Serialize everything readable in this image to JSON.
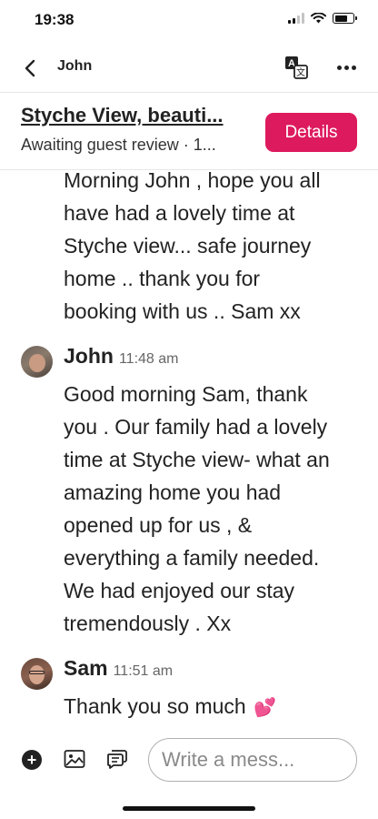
{
  "status_bar": {
    "time": "19:38",
    "signal_bars_active": 2,
    "wifi_icon": "wifi-icon",
    "battery_level": 0.7
  },
  "nav": {
    "back_icon": "chevron-left-icon",
    "title": "John",
    "translate_icon": "translate-icon",
    "more_icon": "ellipsis-icon"
  },
  "listing": {
    "title": "Styche View, beauti...",
    "status": "Awaiting guest review · 1...",
    "details_label": "Details"
  },
  "messages": [
    {
      "sender": "",
      "time": "",
      "text": "Morning John , hope you all\nhave had a lovely time at\nStyche view... safe journey\nhome .. thank you for\nbooking with us .. Sam xx"
    },
    {
      "sender": "John",
      "time": "11:48 am",
      "text": "Good morning Sam, thank\nyou . Our family had a lovely\ntime at Styche view- what an\namazing home you had\nopened up for us , &\neverything a family needed.\nWe had enjoyed  our stay\ntremendously . Xx"
    },
    {
      "sender": "Sam",
      "time": "11:51 am",
      "text": "Thank you so much",
      "emoji": "💕"
    }
  ],
  "composer": {
    "add_icon": "plus-circle-icon",
    "photo_icon": "image-icon",
    "template_icon": "quick-reply-icon",
    "placeholder": "Write a mess..."
  },
  "colors": {
    "accent": "#dd1a5d",
    "text": "#222222",
    "muted": "#666666",
    "heart": "#e64ea1"
  }
}
